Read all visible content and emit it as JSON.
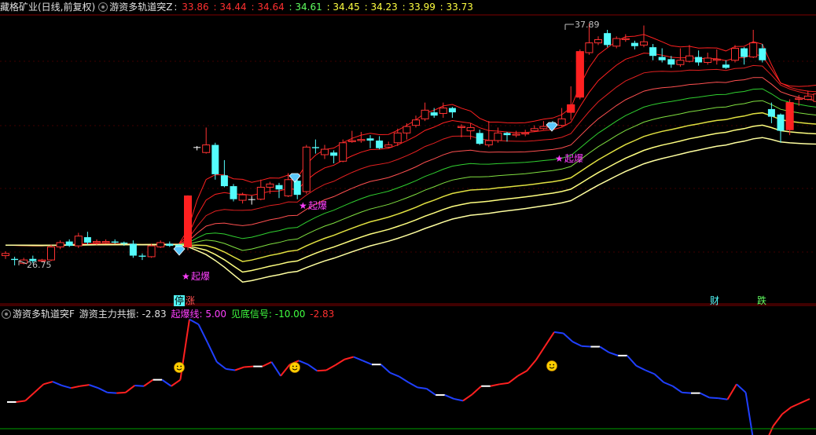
{
  "header_main": {
    "stock": "藏格矿业(日线,前复权)",
    "indicator": "游资多轨道突Z",
    "sep": ":",
    "values": [
      "33.86",
      "34.44",
      "34.64",
      "34.61",
      "34.45",
      "34.23",
      "33.99",
      "33.73"
    ],
    "value_colors": [
      "#ff3030",
      "#ff3030",
      "#ff3030",
      "#60ff60",
      "#ffff40",
      "#ffff40",
      "#ffff40",
      "#ffff40"
    ]
  },
  "header_sub": {
    "indicator": "游资多轨道突F",
    "items": [
      {
        "label": "游资主力共振:",
        "value": "-2.83",
        "color": "#e0e0e0"
      },
      {
        "label": "起爆线:",
        "value": "5.00",
        "color": "#ff40ff"
      },
      {
        "label": "见底信号:",
        "value": "-10.00",
        "color": "#40ff40"
      },
      {
        "label": "",
        "value": "-2.83",
        "color": "#ff3030"
      }
    ]
  },
  "colors": {
    "up": "#ff3232",
    "down": "#54fcfc",
    "doji": "#ffffff",
    "axis": "#a00000"
  },
  "markers": {
    "high_label": "37.89",
    "low_label": "26.75",
    "qibao": "起爆",
    "limit_tags": [
      {
        "text": "停",
        "bg": "#54fcfc",
        "fg": "#000"
      },
      {
        "text": "涨",
        "bg": "#000",
        "fg": "#ff5050"
      }
    ],
    "cai": "财",
    "die": "跌"
  },
  "chart_data": {
    "type": "candlestick",
    "candles": [
      [
        27.2,
        27.3,
        27.4,
        27.05
      ],
      [
        27.05,
        27.0,
        27.15,
        26.75
      ],
      [
        26.85,
        27.0,
        27.1,
        26.8
      ],
      [
        27.05,
        26.95,
        27.2,
        26.85
      ],
      [
        26.95,
        27.0,
        27.05,
        26.9
      ],
      [
        27.0,
        27.6,
        27.7,
        26.95
      ],
      [
        27.6,
        27.8,
        27.9,
        27.5
      ],
      [
        27.85,
        27.65,
        27.95,
        27.6
      ],
      [
        27.65,
        28.1,
        28.25,
        27.55
      ],
      [
        28.05,
        27.8,
        28.3,
        27.7
      ],
      [
        27.8,
        27.85,
        27.95,
        27.7
      ],
      [
        27.8,
        27.85,
        27.95,
        27.75
      ],
      [
        27.85,
        27.8,
        27.95,
        27.75
      ],
      [
        27.8,
        27.75,
        27.85,
        27.65
      ],
      [
        27.75,
        27.2,
        27.9,
        27.1
      ],
      [
        27.2,
        27.15,
        27.3,
        27.0
      ],
      [
        27.15,
        27.65,
        27.75,
        27.1
      ],
      [
        27.6,
        27.8,
        27.9,
        27.55
      ],
      [
        27.75,
        27.65,
        27.85,
        27.6
      ],
      [
        27.7,
        27.6,
        27.75,
        27.4
      ],
      [
        27.6,
        29.95,
        29.98,
        27.45
      ],
      [
        32.2,
        32.2,
        32.25,
        32.05
      ],
      [
        31.95,
        32.3,
        33.1,
        31.9
      ],
      [
        32.3,
        30.95,
        32.4,
        30.7
      ],
      [
        30.9,
        30.4,
        31.6,
        30.35
      ],
      [
        30.4,
        29.8,
        30.5,
        29.7
      ],
      [
        29.75,
        30.0,
        30.1,
        29.6
      ],
      [
        29.8,
        29.8,
        29.95,
        29.55
      ],
      [
        29.8,
        30.35,
        30.7,
        29.75
      ],
      [
        30.35,
        30.5,
        30.6,
        30.05
      ],
      [
        30.45,
        30.25,
        30.55,
        29.85
      ],
      [
        29.95,
        30.7,
        31.0,
        29.9
      ],
      [
        30.65,
        30.0,
        30.75,
        29.8
      ],
      [
        30.15,
        32.2,
        32.3,
        30.05
      ],
      [
        32.2,
        32.15,
        32.55,
        31.9
      ],
      [
        31.85,
        32.1,
        32.3,
        31.65
      ],
      [
        31.95,
        31.8,
        32.05,
        31.45
      ],
      [
        31.55,
        32.4,
        32.55,
        31.5
      ],
      [
        32.45,
        32.5,
        32.95,
        32.4
      ],
      [
        32.5,
        32.55,
        32.9,
        32.4
      ],
      [
        32.6,
        32.5,
        32.75,
        32.15
      ],
      [
        32.5,
        32.15,
        32.7,
        32.1
      ],
      [
        32.2,
        32.3,
        32.45,
        32.15
      ],
      [
        32.4,
        32.85,
        33.05,
        32.25
      ],
      [
        32.85,
        33.15,
        33.3,
        32.55
      ],
      [
        33.2,
        33.45,
        33.65,
        33.1
      ],
      [
        33.5,
        33.9,
        34.25,
        33.4
      ],
      [
        33.8,
        33.65,
        34.0,
        33.55
      ],
      [
        33.75,
        34.0,
        34.25,
        33.55
      ],
      [
        34.0,
        33.8,
        34.05,
        33.55
      ],
      [
        33.1,
        33.15,
        33.25,
        32.65
      ],
      [
        32.95,
        33.1,
        33.3,
        32.55
      ],
      [
        32.85,
        32.35,
        33.0,
        32.3
      ],
      [
        32.3,
        32.5,
        33.4,
        32.2
      ],
      [
        32.5,
        32.85,
        33.1,
        32.4
      ],
      [
        32.85,
        32.75,
        32.9,
        32.45
      ],
      [
        32.75,
        32.8,
        32.95,
        32.65
      ],
      [
        32.8,
        32.85,
        33.0,
        32.7
      ],
      [
        32.95,
        33.05,
        33.2,
        32.9
      ],
      [
        33.05,
        33.15,
        33.4,
        33.0
      ],
      [
        33.25,
        33.15,
        33.4,
        33.0
      ],
      [
        33.2,
        33.5,
        34.0,
        33.15
      ],
      [
        33.8,
        34.15,
        35.0,
        33.45
      ],
      [
        34.5,
        36.6,
        36.7,
        34.4
      ],
      [
        36.55,
        37.0,
        37.89,
        36.45
      ],
      [
        37.0,
        37.15,
        37.3,
        36.9
      ],
      [
        37.45,
        36.9,
        37.6,
        36.8
      ],
      [
        36.85,
        37.2,
        37.3,
        36.75
      ],
      [
        37.15,
        37.2,
        37.4,
        37.05
      ],
      [
        37.0,
        36.85,
        37.1,
        36.7
      ],
      [
        36.9,
        37.05,
        37.8,
        36.8
      ],
      [
        36.8,
        36.4,
        36.95,
        36.2
      ],
      [
        36.35,
        36.2,
        36.75,
        36.1
      ],
      [
        36.25,
        36.0,
        36.4,
        35.85
      ],
      [
        36.0,
        36.2,
        36.75,
        35.9
      ],
      [
        36.15,
        36.4,
        36.9,
        36.1
      ],
      [
        36.35,
        36.1,
        36.65,
        35.95
      ],
      [
        36.1,
        36.3,
        36.55,
        36.0
      ],
      [
        36.2,
        36.25,
        36.7,
        36.0
      ],
      [
        36.0,
        35.85,
        36.2,
        35.8
      ],
      [
        36.2,
        36.75,
        36.9,
        36.1
      ],
      [
        36.75,
        36.35,
        36.8,
        36.0
      ],
      [
        36.35,
        37.0,
        37.6,
        36.3
      ],
      [
        36.75,
        36.2,
        36.95,
        36.1
      ],
      [
        33.95,
        33.6,
        34.25,
        33.3
      ],
      [
        33.7,
        32.95,
        33.75,
        32.4
      ],
      [
        33.0,
        34.25,
        34.4,
        32.75
      ],
      [
        34.4,
        34.45,
        34.6,
        34.1
      ],
      [
        34.4,
        34.55,
        34.8,
        34.35
      ],
      [
        34.3,
        34.65,
        35.05,
        34.2
      ]
    ],
    "y_axis_labels": [
      "37.89",
      "26.75"
    ],
    "osc_values": [
      -3.0,
      -3.0,
      -2.8,
      -1.5,
      -0.2,
      0.2,
      -0.4,
      -0.8,
      -0.5,
      -0.3,
      -0.8,
      -1.5,
      -1.6,
      -1.5,
      -0.4,
      -0.5,
      0.5,
      0.5,
      -0.5,
      0.5,
      10.0,
      9.2,
      6.3,
      3.3,
      2.2,
      2.0,
      2.5,
      2.6,
      2.6,
      3.3,
      1.1,
      2.9,
      3.5,
      2.9,
      1.9,
      2.0,
      2.8,
      3.7,
      4.1,
      3.5,
      2.9,
      2.9,
      1.6,
      1.0,
      0.1,
      -0.7,
      -0.9,
      -1.9,
      -1.9,
      -2.5,
      -2.8,
      -1.8,
      -0.5,
      -0.5,
      -0.2,
      0.0,
      1.1,
      1.9,
      3.6,
      5.8,
      8.0,
      7.8,
      6.5,
      5.8,
      5.7,
      5.7,
      4.8,
      4.3,
      4.3,
      2.7,
      2.0,
      1.4,
      0.1,
      -0.5,
      -1.5,
      -1.6,
      -1.6,
      -2.3,
      -2.4,
      -2.6,
      -0.2,
      -1.5,
      -10.5,
      -10.0,
      -6.8,
      -4.9,
      -3.8
    ]
  }
}
